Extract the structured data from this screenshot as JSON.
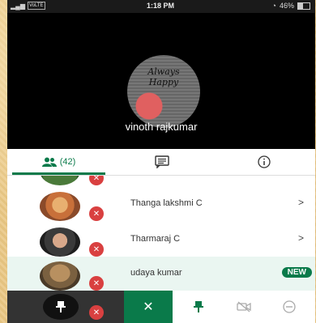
{
  "status_bar": {
    "network": "VoLTE",
    "time": "1:18 PM",
    "battery": "46%"
  },
  "video": {
    "avatar_text": "Always Happy",
    "participant_name": "vinoth rajkumar"
  },
  "tabs": {
    "people_count": "(42)"
  },
  "participants": [
    {
      "name": "Thanga lakshmi C",
      "chevron": ">"
    },
    {
      "name": "Tharmaraj C",
      "chevron": ">"
    },
    {
      "name": "udaya kumar",
      "badge": "NEW"
    }
  ],
  "colors": {
    "accent": "#0a7a4a",
    "mute": "#d94040"
  }
}
